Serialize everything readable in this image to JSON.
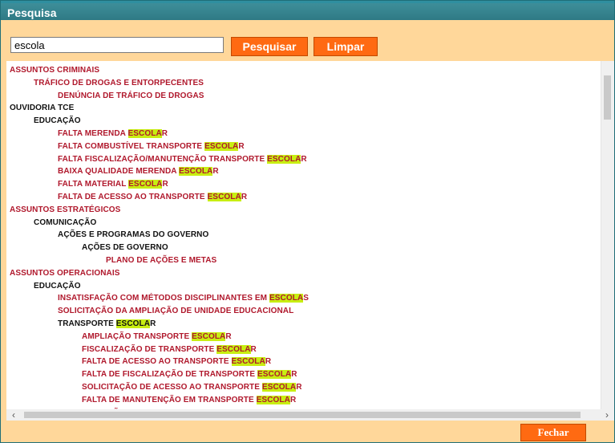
{
  "dialog": {
    "title": "Pesquisa",
    "search": {
      "value": "escola"
    },
    "search_button_label": "Pesquisar",
    "clear_button_label": "Limpar",
    "close_button_label": "Fechar"
  },
  "tree": [
    {
      "pre": "ASSUNTOS CRIMINAIS",
      "hl": "",
      "post": "",
      "level": 0,
      "color": "red"
    },
    {
      "pre": "TRÁFICO DE DROGAS E ENTORPECENTES",
      "hl": "",
      "post": "",
      "level": 1,
      "color": "red"
    },
    {
      "pre": "DENÚNCIA DE TRÁFICO DE DROGAS",
      "hl": "",
      "post": "",
      "level": 2,
      "color": "red"
    },
    {
      "pre": "OUVIDORIA TCE",
      "hl": "",
      "post": "",
      "level": 0,
      "color": "black"
    },
    {
      "pre": "EDUCAÇÃO",
      "hl": "",
      "post": "",
      "level": 1,
      "color": "black"
    },
    {
      "pre": "FALTA MERENDA ",
      "hl": "ESCOLA",
      "post": "R",
      "level": 2,
      "color": "red"
    },
    {
      "pre": "FALTA COMBUSTÍVEL TRANSPORTE ",
      "hl": "ESCOLA",
      "post": "R",
      "level": 2,
      "color": "red"
    },
    {
      "pre": "FALTA FISCALIZAÇÃO/MANUTENÇÃO TRANSPORTE ",
      "hl": "ESCOLA",
      "post": "R",
      "level": 2,
      "color": "red"
    },
    {
      "pre": "BAIXA QUALIDADE MERENDA ",
      "hl": "ESCOLA",
      "post": "R",
      "level": 2,
      "color": "red"
    },
    {
      "pre": "FALTA MATERIAL ",
      "hl": "ESCOLA",
      "post": "R",
      "level": 2,
      "color": "red"
    },
    {
      "pre": "FALTA DE ACESSO AO TRANSPORTE ",
      "hl": "ESCOLA",
      "post": "R",
      "level": 2,
      "color": "red"
    },
    {
      "pre": "ASSUNTOS ESTRATÉGICOS",
      "hl": "",
      "post": "",
      "level": 0,
      "color": "red"
    },
    {
      "pre": "COMUNICAÇÃO",
      "hl": "",
      "post": "",
      "level": 1,
      "color": "black"
    },
    {
      "pre": "AÇÕES E PROGRAMAS DO GOVERNO",
      "hl": "",
      "post": "",
      "level": 2,
      "color": "black"
    },
    {
      "pre": "AÇÕES DE GOVERNO",
      "hl": "",
      "post": "",
      "level": 3,
      "color": "black"
    },
    {
      "pre": "PLANO DE AÇÕES E METAS",
      "hl": "",
      "post": "",
      "level": 4,
      "color": "red"
    },
    {
      "pre": "ASSUNTOS OPERACIONAIS",
      "hl": "",
      "post": "",
      "level": 0,
      "color": "red"
    },
    {
      "pre": "EDUCAÇÃO",
      "hl": "",
      "post": "",
      "level": 1,
      "color": "black"
    },
    {
      "pre": "INSATISFAÇÃO COM MÉTODOS DISCIPLINANTES EM ",
      "hl": "ESCOLA",
      "post": "S",
      "level": 2,
      "color": "red"
    },
    {
      "pre": "SOLICITAÇÃO DA AMPLIAÇÃO DE UNIDADE EDUCACIONAL",
      "hl": "",
      "post": "",
      "level": 2,
      "color": "red"
    },
    {
      "pre": "TRANSPORTE ",
      "hl": "ESCOLA",
      "post": "R",
      "level": 2,
      "color": "black"
    },
    {
      "pre": "AMPLIAÇÃO TRANSPORTE ",
      "hl": "ESCOLA",
      "post": "R",
      "level": 3,
      "color": "red"
    },
    {
      "pre": "FISCALIZAÇÃO DE TRANSPORTE ",
      "hl": "ESCOLA",
      "post": "R",
      "level": 3,
      "color": "red"
    },
    {
      "pre": "FALTA DE ACESSO AO TRANSPORTE ",
      "hl": "ESCOLA",
      "post": "R",
      "level": 3,
      "color": "red"
    },
    {
      "pre": "FALTA DE FISCALIZAÇÃO DE TRANSPORTE ",
      "hl": "ESCOLA",
      "post": "R",
      "level": 3,
      "color": "red"
    },
    {
      "pre": "SOLICITAÇÃO DE ACESSO AO TRANSPORTE ",
      "hl": "ESCOLA",
      "post": "R",
      "level": 3,
      "color": "red"
    },
    {
      "pre": "FALTA DE MANUTENÇÃO EM TRANSPORTE ",
      "hl": "ESCOLA",
      "post": "R",
      "level": 3,
      "color": "red"
    },
    {
      "pre": "SUPERLOTAÇÃO EM SALAS DE AULA",
      "hl": "",
      "post": "",
      "level": 2,
      "color": "red"
    }
  ],
  "colors": {
    "accent": "#ff6a12",
    "panel": "#ffd79a",
    "titlebar": "#2f7a85",
    "highlight": "#c8ee12",
    "item": "#b0182c"
  }
}
